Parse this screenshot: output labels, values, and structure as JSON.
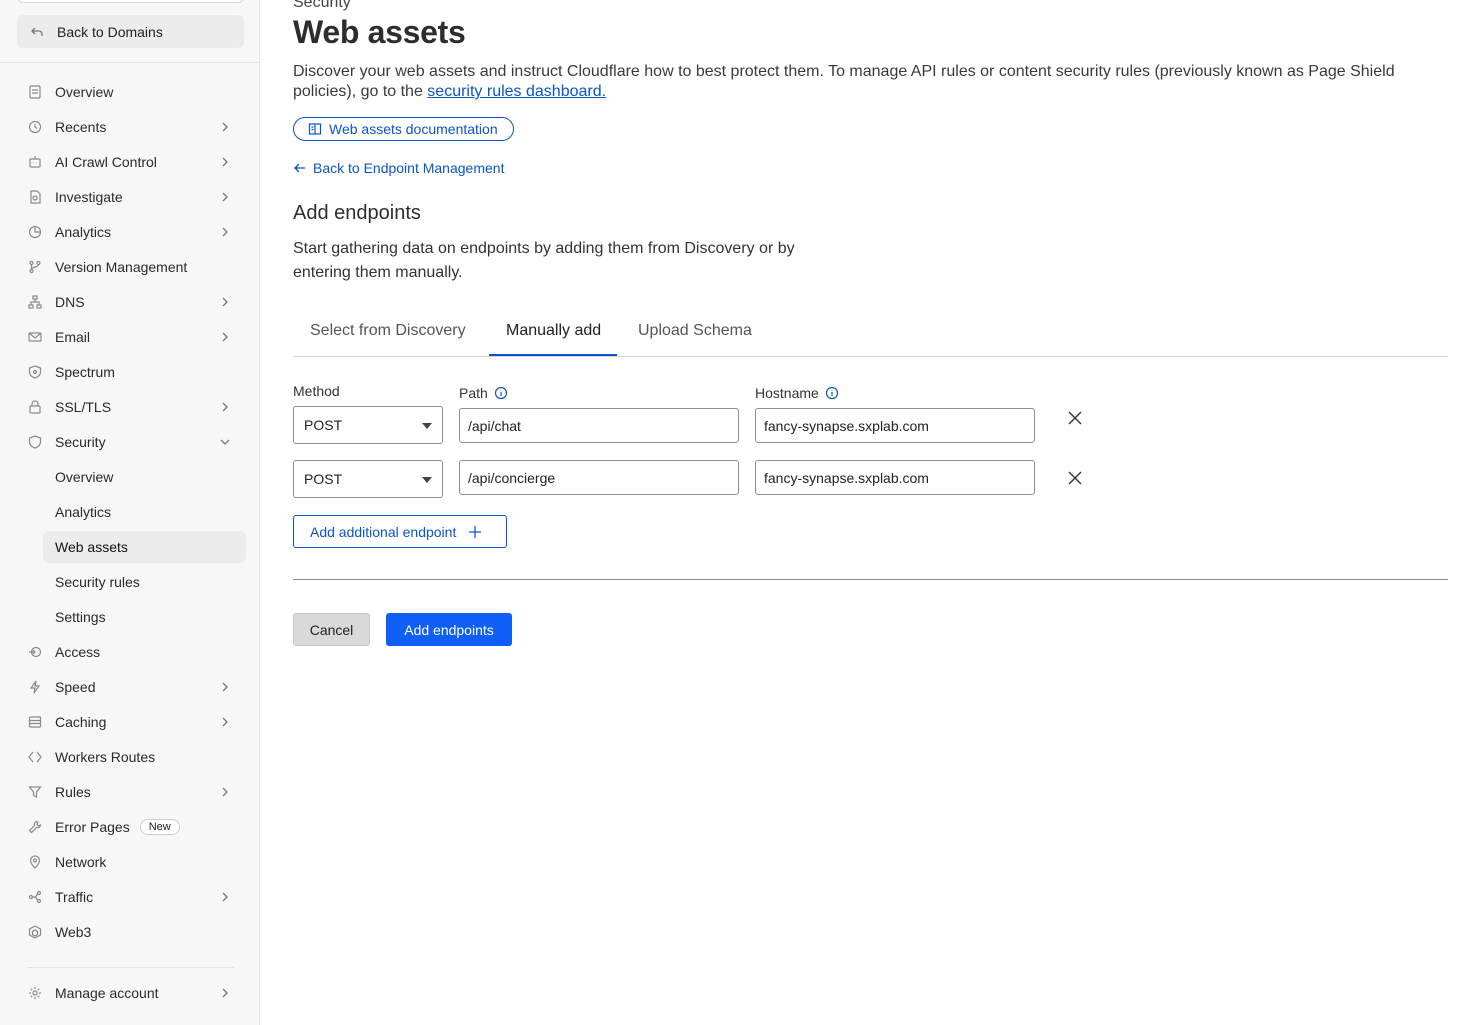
{
  "sidebar": {
    "back_label": "Back to Domains",
    "items": [
      {
        "label": "Overview",
        "icon": "document-icon",
        "chevron": false
      },
      {
        "label": "Recents",
        "icon": "history-icon",
        "chevron": true
      },
      {
        "label": "AI Crawl Control",
        "icon": "robot-icon",
        "chevron": true
      },
      {
        "label": "Investigate",
        "icon": "investigate-icon",
        "chevron": true
      },
      {
        "label": "Analytics",
        "icon": "pie-chart-icon",
        "chevron": true
      },
      {
        "label": "Version Management",
        "icon": "branch-icon",
        "chevron": false
      },
      {
        "label": "DNS",
        "icon": "network-tree-icon",
        "chevron": true
      },
      {
        "label": "Email",
        "icon": "email-icon",
        "chevron": true
      },
      {
        "label": "Spectrum",
        "icon": "spectrum-icon",
        "chevron": false
      },
      {
        "label": "SSL/TLS",
        "icon": "lock-icon",
        "chevron": true
      },
      {
        "label": "Security",
        "icon": "shield-icon",
        "chevron": "down"
      }
    ],
    "security_sub": [
      {
        "label": "Overview"
      },
      {
        "label": "Analytics"
      },
      {
        "label": "Web assets",
        "active": true
      },
      {
        "label": "Security rules"
      },
      {
        "label": "Settings"
      }
    ],
    "items_after": [
      {
        "label": "Access",
        "icon": "access-icon",
        "chevron": false
      },
      {
        "label": "Speed",
        "icon": "lightning-icon",
        "chevron": true
      },
      {
        "label": "Caching",
        "icon": "database-icon",
        "chevron": true
      },
      {
        "label": "Workers Routes",
        "icon": "workers-icon",
        "chevron": false
      },
      {
        "label": "Rules",
        "icon": "funnel-icon",
        "chevron": true
      },
      {
        "label": "Error Pages",
        "icon": "wrench-icon",
        "chevron": false,
        "badge": "New"
      },
      {
        "label": "Network",
        "icon": "location-pin-icon",
        "chevron": false
      },
      {
        "label": "Traffic",
        "icon": "traffic-icon",
        "chevron": true
      },
      {
        "label": "Web3",
        "icon": "web3-icon",
        "chevron": false
      }
    ],
    "manage_account": "Manage account"
  },
  "header": {
    "section": "Security",
    "title": "Web assets",
    "description_prefix": "Discover your web assets and instruct Cloudflare how to best protect them. To manage API rules or content security rules (previously known as Page Shield policies), go to the ",
    "description_link": "security rules dashboard.",
    "docs_button": "Web assets documentation",
    "back_link": "Back to Endpoint Management"
  },
  "add_endpoints": {
    "title": "Add endpoints",
    "description": "Start gathering data on endpoints by adding them from Discovery or by entering them manually.",
    "tabs": [
      "Select from Discovery",
      "Manually add",
      "Upload Schema"
    ],
    "active_tab": "Manually add",
    "labels": {
      "method": "Method",
      "path": "Path",
      "hostname": "Hostname"
    },
    "rows": [
      {
        "method": "POST",
        "path": "/api/chat",
        "hostname": "fancy-synapse.sxplab.com"
      },
      {
        "method": "POST",
        "path": "/api/concierge",
        "hostname": "fancy-synapse.sxplab.com"
      }
    ],
    "add_additional": "Add additional endpoint",
    "cancel": "Cancel",
    "submit": "Add endpoints"
  },
  "colors": {
    "accent": "#0a55c8",
    "primary_button": "#0f5ff7"
  }
}
